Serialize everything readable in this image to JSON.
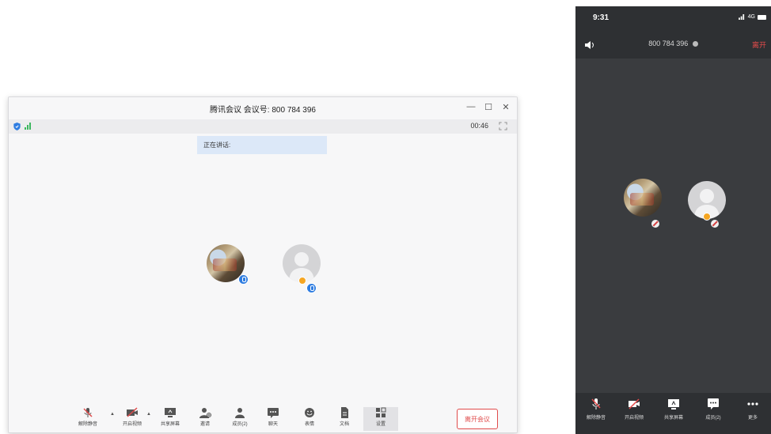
{
  "desktop": {
    "title": "腾讯会议 会议号: 800 784 396",
    "window_controls": {
      "minimize": "—",
      "maximize": "☐",
      "close": "✕"
    },
    "timer": "00:46",
    "speaking_label": "正在讲话:",
    "toolbar": {
      "unmute": "解除静音",
      "start_video": "开启视频",
      "share_screen": "共享屏幕",
      "invite": "邀请",
      "members": "成员(2)",
      "chat": "聊天",
      "reactions": "表情",
      "documents": "文档",
      "settings": "设置",
      "leave": "离开会议"
    },
    "colors": {
      "leave": "#e04b4b",
      "speaking_bg": "#dce8f8",
      "mic_badge": "#2f7de1"
    }
  },
  "phone": {
    "time": "9:31",
    "network": "4G",
    "meeting_id": "800 784 396",
    "leave": "离开",
    "toolbar": {
      "unmute": "解除静音",
      "start_video": "开启视频",
      "share_screen": "共享屏幕",
      "members": "成员(2)",
      "more": "更多"
    },
    "colors": {
      "background": "#3a3c3f",
      "leave": "#e64b4b"
    }
  }
}
